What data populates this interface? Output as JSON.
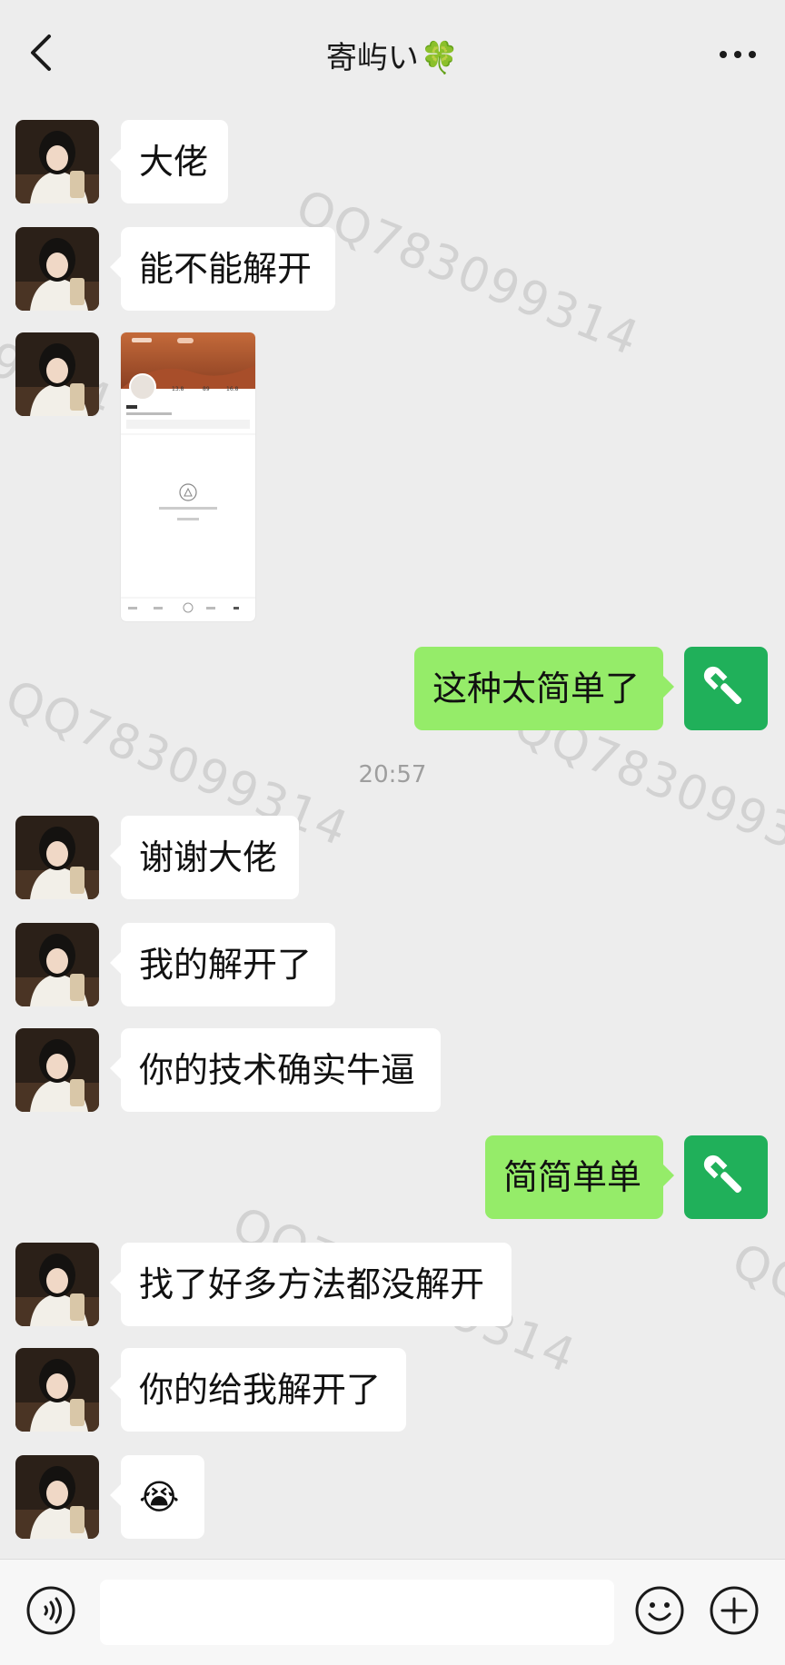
{
  "header": {
    "title": "寄屿い",
    "title_emoji": "🍀"
  },
  "watermark": "QQ783099314",
  "messages": [
    {
      "side": "in",
      "type": "text",
      "text": "大佬"
    },
    {
      "side": "in",
      "type": "text",
      "text": "能不能解开"
    },
    {
      "side": "in",
      "type": "image"
    },
    {
      "side": "out",
      "type": "text",
      "text": "这种太简单了"
    },
    {
      "type": "time",
      "text": "20:57"
    },
    {
      "side": "in",
      "type": "text",
      "text": "谢谢大佬"
    },
    {
      "side": "in",
      "type": "text",
      "text": "我的解开了"
    },
    {
      "side": "in",
      "type": "text",
      "text": "你的技术确实牛逼"
    },
    {
      "side": "out",
      "type": "text",
      "text": "简简单单"
    },
    {
      "side": "in",
      "type": "text",
      "text": "找了好多方法都没解开"
    },
    {
      "side": "in",
      "type": "text",
      "text": "你的给我解开了"
    },
    {
      "side": "in",
      "type": "text",
      "text": "😭"
    }
  ],
  "colors": {
    "background": "#ededed",
    "incoming_bubble": "#ffffff",
    "outgoing_bubble": "#95ec69",
    "self_avatar": "#20b05a"
  },
  "icons": {
    "back": "chevron-left-icon",
    "more": "more-dots-icon",
    "voice": "voice-icon",
    "emoji": "emoji-icon",
    "add": "plus-icon",
    "self_avatar": "wrench-icon"
  }
}
